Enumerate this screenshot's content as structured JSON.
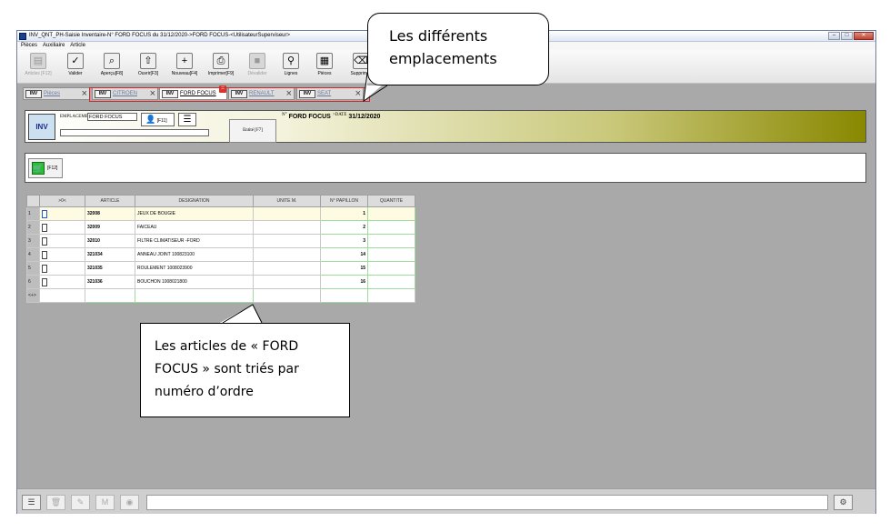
{
  "window": {
    "title": "INV_QNT_PH-Saisie Inventaire-N° FORD FOCUS du 31/12/2020->FORD FOCUS-<UtilisateurSuperviseur>",
    "controls": [
      "–",
      "□",
      "✕"
    ]
  },
  "menu": [
    "Pièces",
    "Auxiliaire",
    "Article"
  ],
  "toolbar": [
    {
      "label": "Articles [F12]",
      "icon": "articles-icon",
      "disabled": true,
      "glyph": "▤"
    },
    {
      "label": "Valider",
      "icon": "check-icon",
      "glyph": "✓"
    },
    {
      "label": "Aperçu[F8]",
      "icon": "preview-icon",
      "glyph": "⌕"
    },
    {
      "label": "Ouvrir[F3]",
      "icon": "open-icon",
      "glyph": "⇧"
    },
    {
      "label": "Nouveau[F4]",
      "icon": "new-icon",
      "glyph": "+"
    },
    {
      "label": "Imprimer[F9]",
      "icon": "print-icon",
      "glyph": "⎙"
    },
    {
      "label": "Dévalider",
      "icon": "unvalidate-icon",
      "disabled": true,
      "glyph": "■"
    },
    {
      "label": "Lignes",
      "icon": "search-icon",
      "glyph": "⚲"
    },
    {
      "label": "Pièces",
      "icon": "grid-icon",
      "glyph": "▦"
    },
    {
      "label": "Supprimer",
      "icon": "delete-icon",
      "glyph": "⌫"
    }
  ],
  "tabs": [
    {
      "label": "Pièces",
      "icon_text": "INV",
      "active": false
    },
    {
      "label": "CITROEN",
      "icon_text": "INV",
      "active": false
    },
    {
      "label": "FORD FOCUS",
      "icon_text": "INV",
      "active": true
    },
    {
      "label": "RENAULT",
      "icon_text": "INV",
      "active": false
    },
    {
      "label": "SEAT",
      "icon_text": "INV",
      "active": false
    }
  ],
  "header": {
    "logo": "INV",
    "emplacement_label": "EMPLACEMENT",
    "emplacement_value": "FORD FOCUS",
    "user_key": "[F11]",
    "entite": "Entité [F7]",
    "doc_prefix": "N°",
    "doc_number": "FORD FOCUS",
    "date_label": "DATE",
    "date_value": "31/12/2020"
  },
  "action": {
    "key": "[F12]"
  },
  "grid": {
    "columns": [
      ">0<",
      "ARTICLE",
      "DESIGNATION",
      "UNITE M.",
      "N° PAPILLON",
      "QUANTITE"
    ],
    "rows": [
      {
        "n": "1",
        "article": "32008",
        "designation": "JEUX DE BOUGIE",
        "unite": "",
        "papillon": "1",
        "quantite": ""
      },
      {
        "n": "2",
        "article": "32009",
        "designation": "FAICEAU",
        "unite": "",
        "papillon": "2",
        "quantite": ""
      },
      {
        "n": "3",
        "article": "32010",
        "designation": "FILTRE CLIMATISEUR -FORD",
        "unite": "",
        "papillon": "3",
        "quantite": ""
      },
      {
        "n": "4",
        "article": "321034",
        "designation": "ANNEAU JOINT 100823100",
        "unite": "",
        "papillon": "14",
        "quantite": ""
      },
      {
        "n": "5",
        "article": "321035",
        "designation": "ROULEMENT 1008023900",
        "unite": "",
        "papillon": "15",
        "quantite": ""
      },
      {
        "n": "6",
        "article": "321036",
        "designation": "BOUCHON 1008021800",
        "unite": "",
        "papillon": "16",
        "quantite": ""
      }
    ],
    "new_row_marker": "<+>"
  },
  "statusbar": [
    "menu-icon",
    "trash-icon",
    "edit-icon",
    "mail-icon",
    "eye-icon",
    "settings-icon"
  ],
  "callouts": {
    "emplacements": [
      "Les différents",
      "emplacements"
    ],
    "articles": [
      "Les articles de « FORD",
      "FOCUS » sont triés par",
      "numéro d’ordre"
    ]
  }
}
